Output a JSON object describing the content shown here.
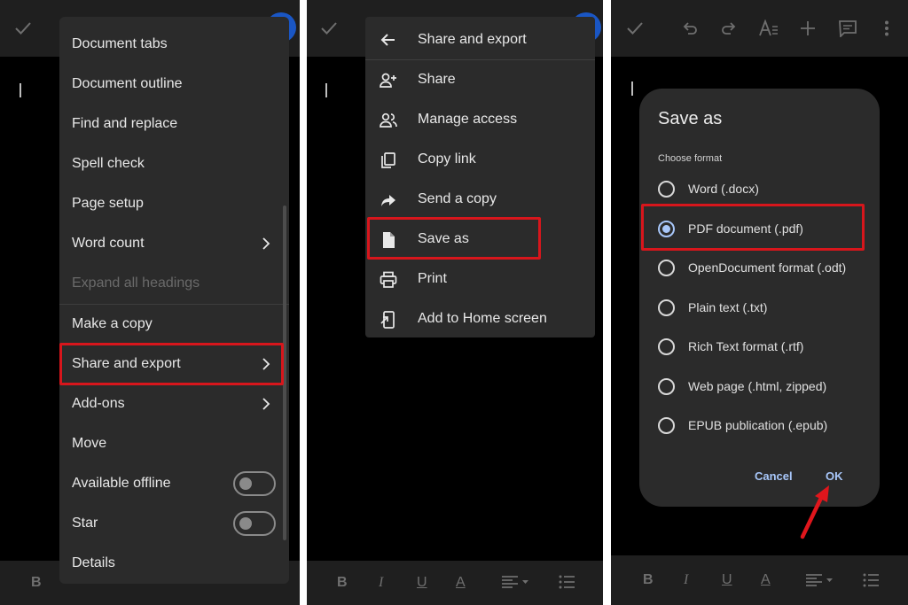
{
  "panel1": {
    "menu": {
      "items": [
        {
          "label": "Document tabs"
        },
        {
          "label": "Document outline"
        },
        {
          "label": "Find and replace"
        },
        {
          "label": "Spell check"
        },
        {
          "label": "Page setup"
        },
        {
          "label": "Word count",
          "has_submenu": true
        },
        {
          "label": "Expand all headings",
          "disabled": true
        },
        {
          "label": "Make a copy"
        },
        {
          "label": "Share and export",
          "has_submenu": true,
          "highlighted": true
        },
        {
          "label": "Add-ons",
          "has_submenu": true
        },
        {
          "label": "Move"
        },
        {
          "label": "Available offline",
          "toggle": "off"
        },
        {
          "label": "Star",
          "toggle": "off"
        },
        {
          "label": "Details"
        }
      ]
    },
    "toolbar_bold": "B"
  },
  "panel2": {
    "menu": {
      "header": "Share and export",
      "items": [
        {
          "label": "Share",
          "icon": "person-add-icon"
        },
        {
          "label": "Manage access",
          "icon": "people-icon"
        },
        {
          "label": "Copy link",
          "icon": "copy-icon"
        },
        {
          "label": "Send a copy",
          "icon": "forward-arrow-icon"
        },
        {
          "label": "Save as",
          "icon": "file-icon",
          "highlighted": true
        },
        {
          "label": "Print",
          "icon": "print-icon"
        },
        {
          "label": "Add to Home screen",
          "icon": "add-to-home-icon"
        }
      ]
    },
    "toolbar": {
      "bold": "B",
      "italic": "I",
      "underline": "U",
      "text_color": "A"
    }
  },
  "panel3": {
    "dialog": {
      "title": "Save as",
      "subtitle": "Choose format",
      "options": [
        {
          "label": "Word (.docx)",
          "selected": false
        },
        {
          "label": "PDF document (.pdf)",
          "selected": true
        },
        {
          "label": "OpenDocument format (.odt)",
          "selected": false
        },
        {
          "label": "Plain text (.txt)",
          "selected": false
        },
        {
          "label": "Rich Text format (.rtf)",
          "selected": false
        },
        {
          "label": "Web page (.html, zipped)",
          "selected": false
        },
        {
          "label": "EPUB publication (.epub)",
          "selected": false
        }
      ],
      "cancel_label": "Cancel",
      "ok_label": "OK"
    },
    "toolbar": {
      "bold": "B",
      "italic": "I",
      "underline": "U",
      "text_color": "A"
    }
  },
  "colors": {
    "highlight": "#d7161c",
    "accent": "#a8c7fa",
    "menu_bg": "#2b2b2b",
    "bar_bg": "#1f1f1f"
  }
}
